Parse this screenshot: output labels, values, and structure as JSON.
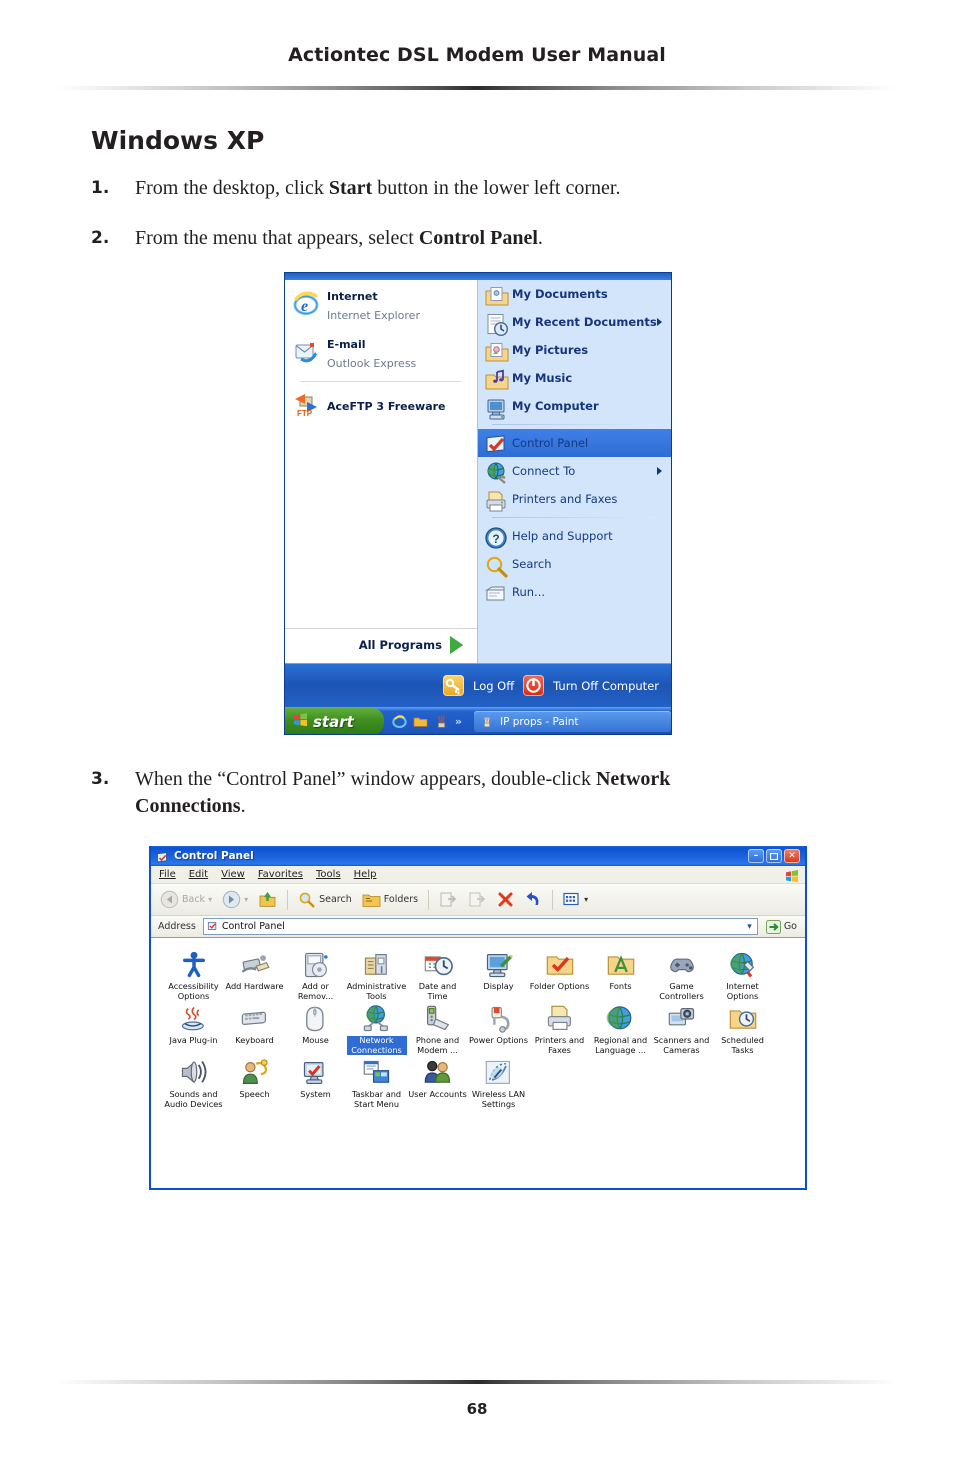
{
  "header": {
    "title": "Actiontec DSL Modem User Manual"
  },
  "footer": {
    "page_number": "68"
  },
  "section": {
    "title": "Windows XP"
  },
  "steps": [
    {
      "num": "1.",
      "text_before": "From the desktop, click ",
      "bold": "Start",
      "text_after": " button in the lower left corner."
    },
    {
      "num": "2.",
      "text_before": "From the menu that appears, select ",
      "bold": "Control Panel",
      "text_after": "."
    },
    {
      "num": "3.",
      "text_before": "When the “Control Panel” window appears, double-click ",
      "bold": "Network Connections",
      "text_after": "."
    }
  ],
  "start_menu": {
    "left_items": [
      {
        "icon": "internet-explorer-icon",
        "title": "Internet",
        "subtitle": "Internet Explorer"
      },
      {
        "icon": "outlook-express-icon",
        "title": "E-mail",
        "subtitle": "Outlook Express"
      },
      {
        "icon": "aceftp-icon",
        "title": "AceFTP 3 Freeware",
        "subtitle": ""
      }
    ],
    "all_programs_label": "All Programs",
    "right_items": [
      {
        "icon": "my-documents-icon",
        "label": "My Documents",
        "arrow": false,
        "selected": false,
        "bold": true
      },
      {
        "icon": "my-recent-documents-icon",
        "label": "My Recent Documents",
        "arrow": true,
        "selected": false,
        "bold": true
      },
      {
        "icon": "my-pictures-icon",
        "label": "My Pictures",
        "arrow": false,
        "selected": false,
        "bold": true
      },
      {
        "icon": "my-music-icon",
        "label": "My Music",
        "arrow": false,
        "selected": false,
        "bold": true
      },
      {
        "icon": "my-computer-icon",
        "label": "My Computer",
        "arrow": false,
        "selected": false,
        "bold": true
      },
      {
        "icon": "control-panel-icon",
        "label": "Control Panel",
        "arrow": false,
        "selected": true,
        "bold": false
      },
      {
        "icon": "connect-to-icon",
        "label": "Connect To",
        "arrow": true,
        "selected": false,
        "bold": false
      },
      {
        "icon": "printers-and-faxes-icon",
        "label": "Printers and Faxes",
        "arrow": false,
        "selected": false,
        "bold": false
      },
      {
        "icon": "help-and-support-icon",
        "label": "Help and Support",
        "arrow": false,
        "selected": false,
        "bold": false
      },
      {
        "icon": "search-icon",
        "label": "Search",
        "arrow": false,
        "selected": false,
        "bold": false
      },
      {
        "icon": "run-icon",
        "label": "Run...",
        "arrow": false,
        "selected": false,
        "bold": false
      }
    ],
    "log_off_label": "Log Off",
    "turn_off_label": "Turn Off Computer",
    "taskbar": {
      "start_label": "start",
      "quick_launch_overflow": "»",
      "task_button_label": "IP props - Paint"
    }
  },
  "control_panel": {
    "window_title": "Control Panel",
    "window_buttons": {
      "minimize": "–",
      "maximize": "❐",
      "close": "✕"
    },
    "menu": [
      "File",
      "Edit",
      "View",
      "Favorites",
      "Tools",
      "Help"
    ],
    "toolbar": [
      {
        "name": "back-button",
        "label": "Back",
        "disabled": true
      },
      {
        "name": "forward-button",
        "label": "",
        "disabled": true
      },
      {
        "name": "up-button",
        "label": "",
        "disabled": false
      },
      {
        "name": "search-button",
        "label": "Search",
        "disabled": false
      },
      {
        "name": "folders-button",
        "label": "Folders",
        "disabled": false
      },
      {
        "name": "move-to-button",
        "label": "",
        "disabled": true
      },
      {
        "name": "copy-to-button",
        "label": "",
        "disabled": true
      },
      {
        "name": "delete-button",
        "label": "",
        "disabled": false
      },
      {
        "name": "undo-button",
        "label": "",
        "disabled": false
      },
      {
        "name": "views-button",
        "label": "",
        "disabled": false
      }
    ],
    "address_label": "Address",
    "address_value": "Control Panel",
    "go_label": "Go",
    "icons": [
      {
        "label": "Accessibility Options",
        "icon": "accessibility-icon",
        "selected": false
      },
      {
        "label": "Add Hardware",
        "icon": "add-hardware-icon",
        "selected": false
      },
      {
        "label": "Add or Remov...",
        "icon": "add-remove-programs-icon",
        "selected": false
      },
      {
        "label": "Administrative Tools",
        "icon": "administrative-tools-icon",
        "selected": false
      },
      {
        "label": "Date and Time",
        "icon": "date-and-time-icon",
        "selected": false
      },
      {
        "label": "Display",
        "icon": "display-icon",
        "selected": false
      },
      {
        "label": "Folder Options",
        "icon": "folder-options-icon",
        "selected": false
      },
      {
        "label": "Fonts",
        "icon": "fonts-icon",
        "selected": false
      },
      {
        "label": "Game Controllers",
        "icon": "game-controllers-icon",
        "selected": false
      },
      {
        "label": "Internet Options",
        "icon": "internet-options-icon",
        "selected": false
      },
      {
        "label": "Java Plug-in",
        "icon": "java-plugin-icon",
        "selected": false
      },
      {
        "label": "Keyboard",
        "icon": "keyboard-icon",
        "selected": false
      },
      {
        "label": "Mouse",
        "icon": "mouse-icon",
        "selected": false
      },
      {
        "label": "Network Connections",
        "icon": "network-connections-icon",
        "selected": true
      },
      {
        "label": "Phone and Modem ...",
        "icon": "phone-and-modem-icon",
        "selected": false
      },
      {
        "label": "Power Options",
        "icon": "power-options-icon",
        "selected": false
      },
      {
        "label": "Printers and Faxes",
        "icon": "printers-and-faxes-icon",
        "selected": false
      },
      {
        "label": "Regional and Language ...",
        "icon": "regional-options-icon",
        "selected": false
      },
      {
        "label": "Scanners and Cameras",
        "icon": "scanners-and-cameras-icon",
        "selected": false
      },
      {
        "label": "Scheduled Tasks",
        "icon": "scheduled-tasks-icon",
        "selected": false
      },
      {
        "label": "Sounds and Audio Devices",
        "icon": "sounds-and-audio-icon",
        "selected": false
      },
      {
        "label": "Speech",
        "icon": "speech-icon",
        "selected": false
      },
      {
        "label": "System",
        "icon": "system-icon",
        "selected": false
      },
      {
        "label": "Taskbar and Start Menu",
        "icon": "taskbar-start-menu-icon",
        "selected": false
      },
      {
        "label": "User Accounts",
        "icon": "user-accounts-icon",
        "selected": false
      },
      {
        "label": "Wireless LAN Settings",
        "icon": "wireless-lan-icon",
        "selected": false
      }
    ]
  },
  "colors": {
    "xp_blue": "#0b4fd6",
    "selection_blue": "#2f6dd4",
    "start_green": "#3f8f20",
    "menu_panel_blue": "#d3e5fa"
  }
}
